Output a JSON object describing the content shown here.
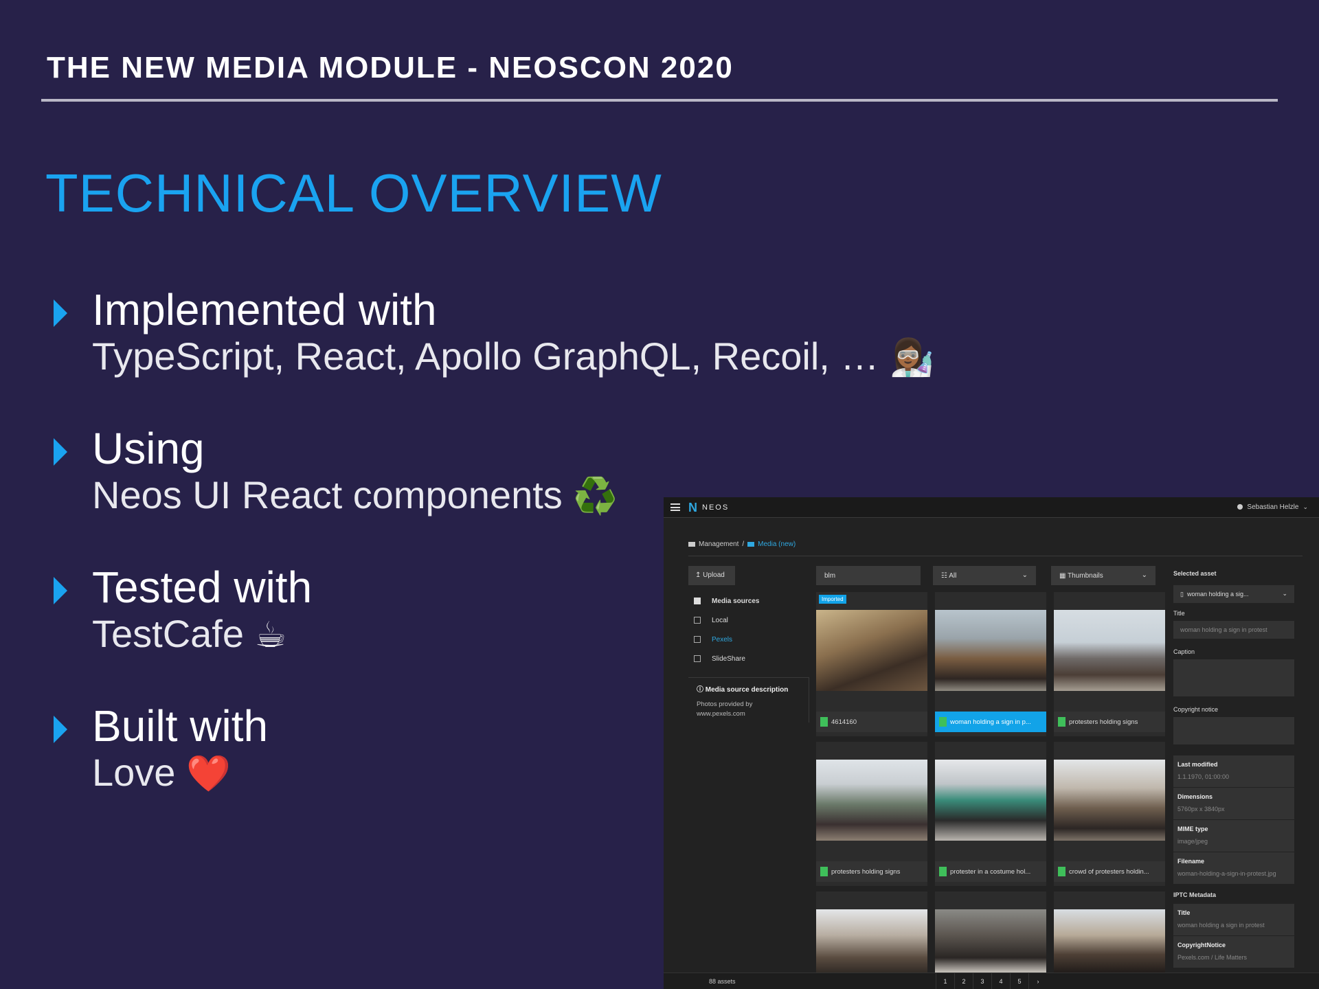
{
  "slide": {
    "header": "THE NEW MEDIA MODULE - NEOSCON 2020",
    "section_title": "TECHNICAL OVERVIEW",
    "bullets": [
      {
        "head": "Implemented with",
        "sub": "TypeScript, React, Apollo GraphQL, Recoil, …",
        "emoji": "👩🏾‍🔬",
        "emoji_icon": "scientist-emoji"
      },
      {
        "head": "Using",
        "sub": "Neos UI React components",
        "emoji": "♻️",
        "emoji_icon": "recycle-emoji"
      },
      {
        "head": "Tested with",
        "sub": "TestCafe",
        "emoji": "☕",
        "emoji_icon": "coffee-emoji"
      },
      {
        "head": "Built with",
        "sub": "Love",
        "emoji": "❤️",
        "emoji_icon": "heart-emoji"
      }
    ],
    "colors": {
      "background": "#272149",
      "accent": "#1aa3f0",
      "rule": "#b9b7c6"
    }
  },
  "app": {
    "logo": "NEOS",
    "logo_mark": "N",
    "user": "Sebastian Helzle",
    "breadcrumb": {
      "parent": "Management",
      "separator": "/",
      "current": "Media (new)"
    },
    "upload_label": "Upload",
    "sources": {
      "heading": "Media sources",
      "items": [
        "Local",
        "Pexels",
        "SlideShare"
      ],
      "selected": "Pexels"
    },
    "source_description": {
      "title": "Media source description",
      "body": "Photos provided by www.pexels.com"
    },
    "search_value": "blm",
    "filter_value": "All",
    "view_value": "Thumbnails",
    "tiles": [
      {
        "caption": "4614160",
        "badge": "Imported",
        "selected": false
      },
      {
        "caption": "woman holding a sign in p...",
        "badge": "",
        "selected": true
      },
      {
        "caption": "protesters holding signs",
        "badge": "",
        "selected": false
      },
      {
        "caption": "protesters holding signs",
        "badge": "",
        "selected": false
      },
      {
        "caption": "protester in a costume hol...",
        "badge": "",
        "selected": false
      },
      {
        "caption": "crowd of protesters holdin...",
        "badge": "",
        "selected": false
      },
      {
        "caption": "",
        "badge": "",
        "selected": false
      },
      {
        "caption": "",
        "badge": "",
        "selected": false
      },
      {
        "caption": "",
        "badge": "",
        "selected": false
      }
    ],
    "inspector": {
      "heading": "Selected asset",
      "asset_select": "woman holding a sig...",
      "title_label": "Title",
      "title_value": "woman holding a sign in protest",
      "caption_label": "Caption",
      "copyright_label": "Copyright notice",
      "properties": [
        {
          "key": "Last modified",
          "value": "1.1.1970, 01:00:00"
        },
        {
          "key": "Dimensions",
          "value": "5760px x 3840px"
        },
        {
          "key": "MIME type",
          "value": "image/jpeg"
        },
        {
          "key": "Filename",
          "value": "woman-holding-a-sign-in-protest.jpg"
        }
      ],
      "iptc_heading": "IPTC Metadata",
      "iptc": [
        {
          "key": "Title",
          "value": "woman holding a sign in protest"
        },
        {
          "key": "CopyrightNotice",
          "value": "Pexels.com / Life Matters"
        }
      ]
    },
    "footer": {
      "asset_count": "88 assets",
      "pages": [
        "1",
        "2",
        "3",
        "4",
        "5",
        "›"
      ]
    }
  }
}
